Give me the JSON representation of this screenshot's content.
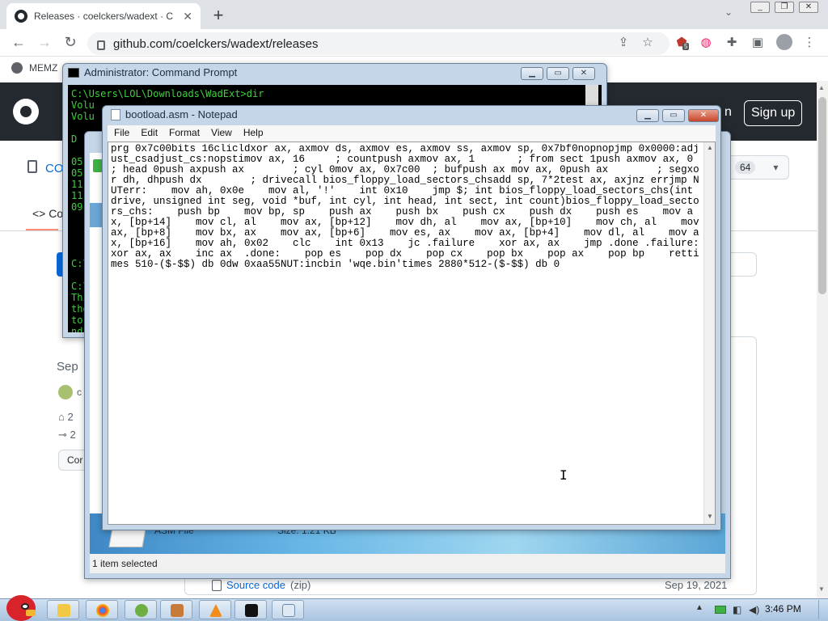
{
  "browser": {
    "tab_title": "Releases · coelckers/wadext · C",
    "url": "github.com/coelckers/wadext/releases",
    "bookmark_label": "MEMZ",
    "extension_badge": "5"
  },
  "github": {
    "signin_fragment": "n",
    "signup_label": "Sign up",
    "repo_owner_fragment": "CO",
    "code_tab_fragment": "<> Co",
    "star_count": "64",
    "release_date_fragment": "Sep",
    "avatar_label_fragment": "c",
    "tag_fragment": "2",
    "commit_fragment": "2",
    "compare_fragment": "Cor",
    "source_code_label": "Source code",
    "source_code_format": "(zip)",
    "source_code_date": "Sep 19, 2021"
  },
  "cmd": {
    "title": "Administrator: Command Prompt",
    "lines": [
      "C:\\Users\\LOL\\Downloads\\WadExt>dir",
      " Volu",
      " Volu",
      "",
      " D",
      "",
      "05,",
      "05,",
      "11,",
      "11,",
      "09,",
      "",
      "",
      "",
      "",
      "C:\\",
      "",
      "C:\\",
      "This",
      "the",
      "to",
      "nd",
      "",
      "C:\\"
    ]
  },
  "explorer": {
    "file_type": "ASM File",
    "file_size": "Size: 1.21 KB",
    "status": "1 item selected"
  },
  "notepad": {
    "title": "bootload.asm - Notepad",
    "menu": [
      "File",
      "Edit",
      "Format",
      "View",
      "Help"
    ],
    "content": "prg 0x7c00bits 16clicldxor ax, axmov ds, axmov es, axmov ss, axmov sp, 0x7bf0nopnopjmp 0x0000:adjust_csadjust_cs:nopstimov ax, 16     ; countpush axmov ax, 1       ; from sect 1push axmov ax, 0       ; head 0push axpush ax        ; cyl 0mov ax, 0x7c00  ; bufpush ax mov ax, 0push ax        ; segxor dh, dhpush dx        ; drivecall bios_floppy_load_sectors_chsadd sp, 7*2test ax, axjnz errjmp NUTerr:    mov ah, 0x0e    mov al, '!'    int 0x10    jmp $; int bios_floppy_load_sectors_chs(int drive, unsigned int seg, void *buf, int cyl, int head, int sect, int count)bios_floppy_load_sectors_chs:    push bp    mov bp, sp    push ax    push bx    push cx    push dx    push es    mov ax, [bp+14]    mov cl, al    mov ax, [bp+12]    mov dh, al    mov ax, [bp+10]    mov ch, al    mov ax, [bp+8]    mov bx, ax    mov ax, [bp+6]    mov es, ax    mov ax, [bp+4]    mov dl, al    mov ax, [bp+16]    mov ah, 0x02    clc    int 0x13    jc .failure    xor ax, ax    jmp .done .failure:    xor ax, ax    inc ax  .done:    pop es    pop dx    pop cx    pop bx    pop ax    pop bp    rettimes 510-($-$$) db 0dw 0xaa55NUT:incbin 'wqe.bin'times 2880*512-($-$$) db 0"
  },
  "taskbar": {
    "clock": "3:46 PM"
  },
  "colors": {
    "github_header": "#24292f",
    "cmd_text": "#3cd13c",
    "taskbar": "#a9c3df",
    "close_button": "#c8452c"
  }
}
